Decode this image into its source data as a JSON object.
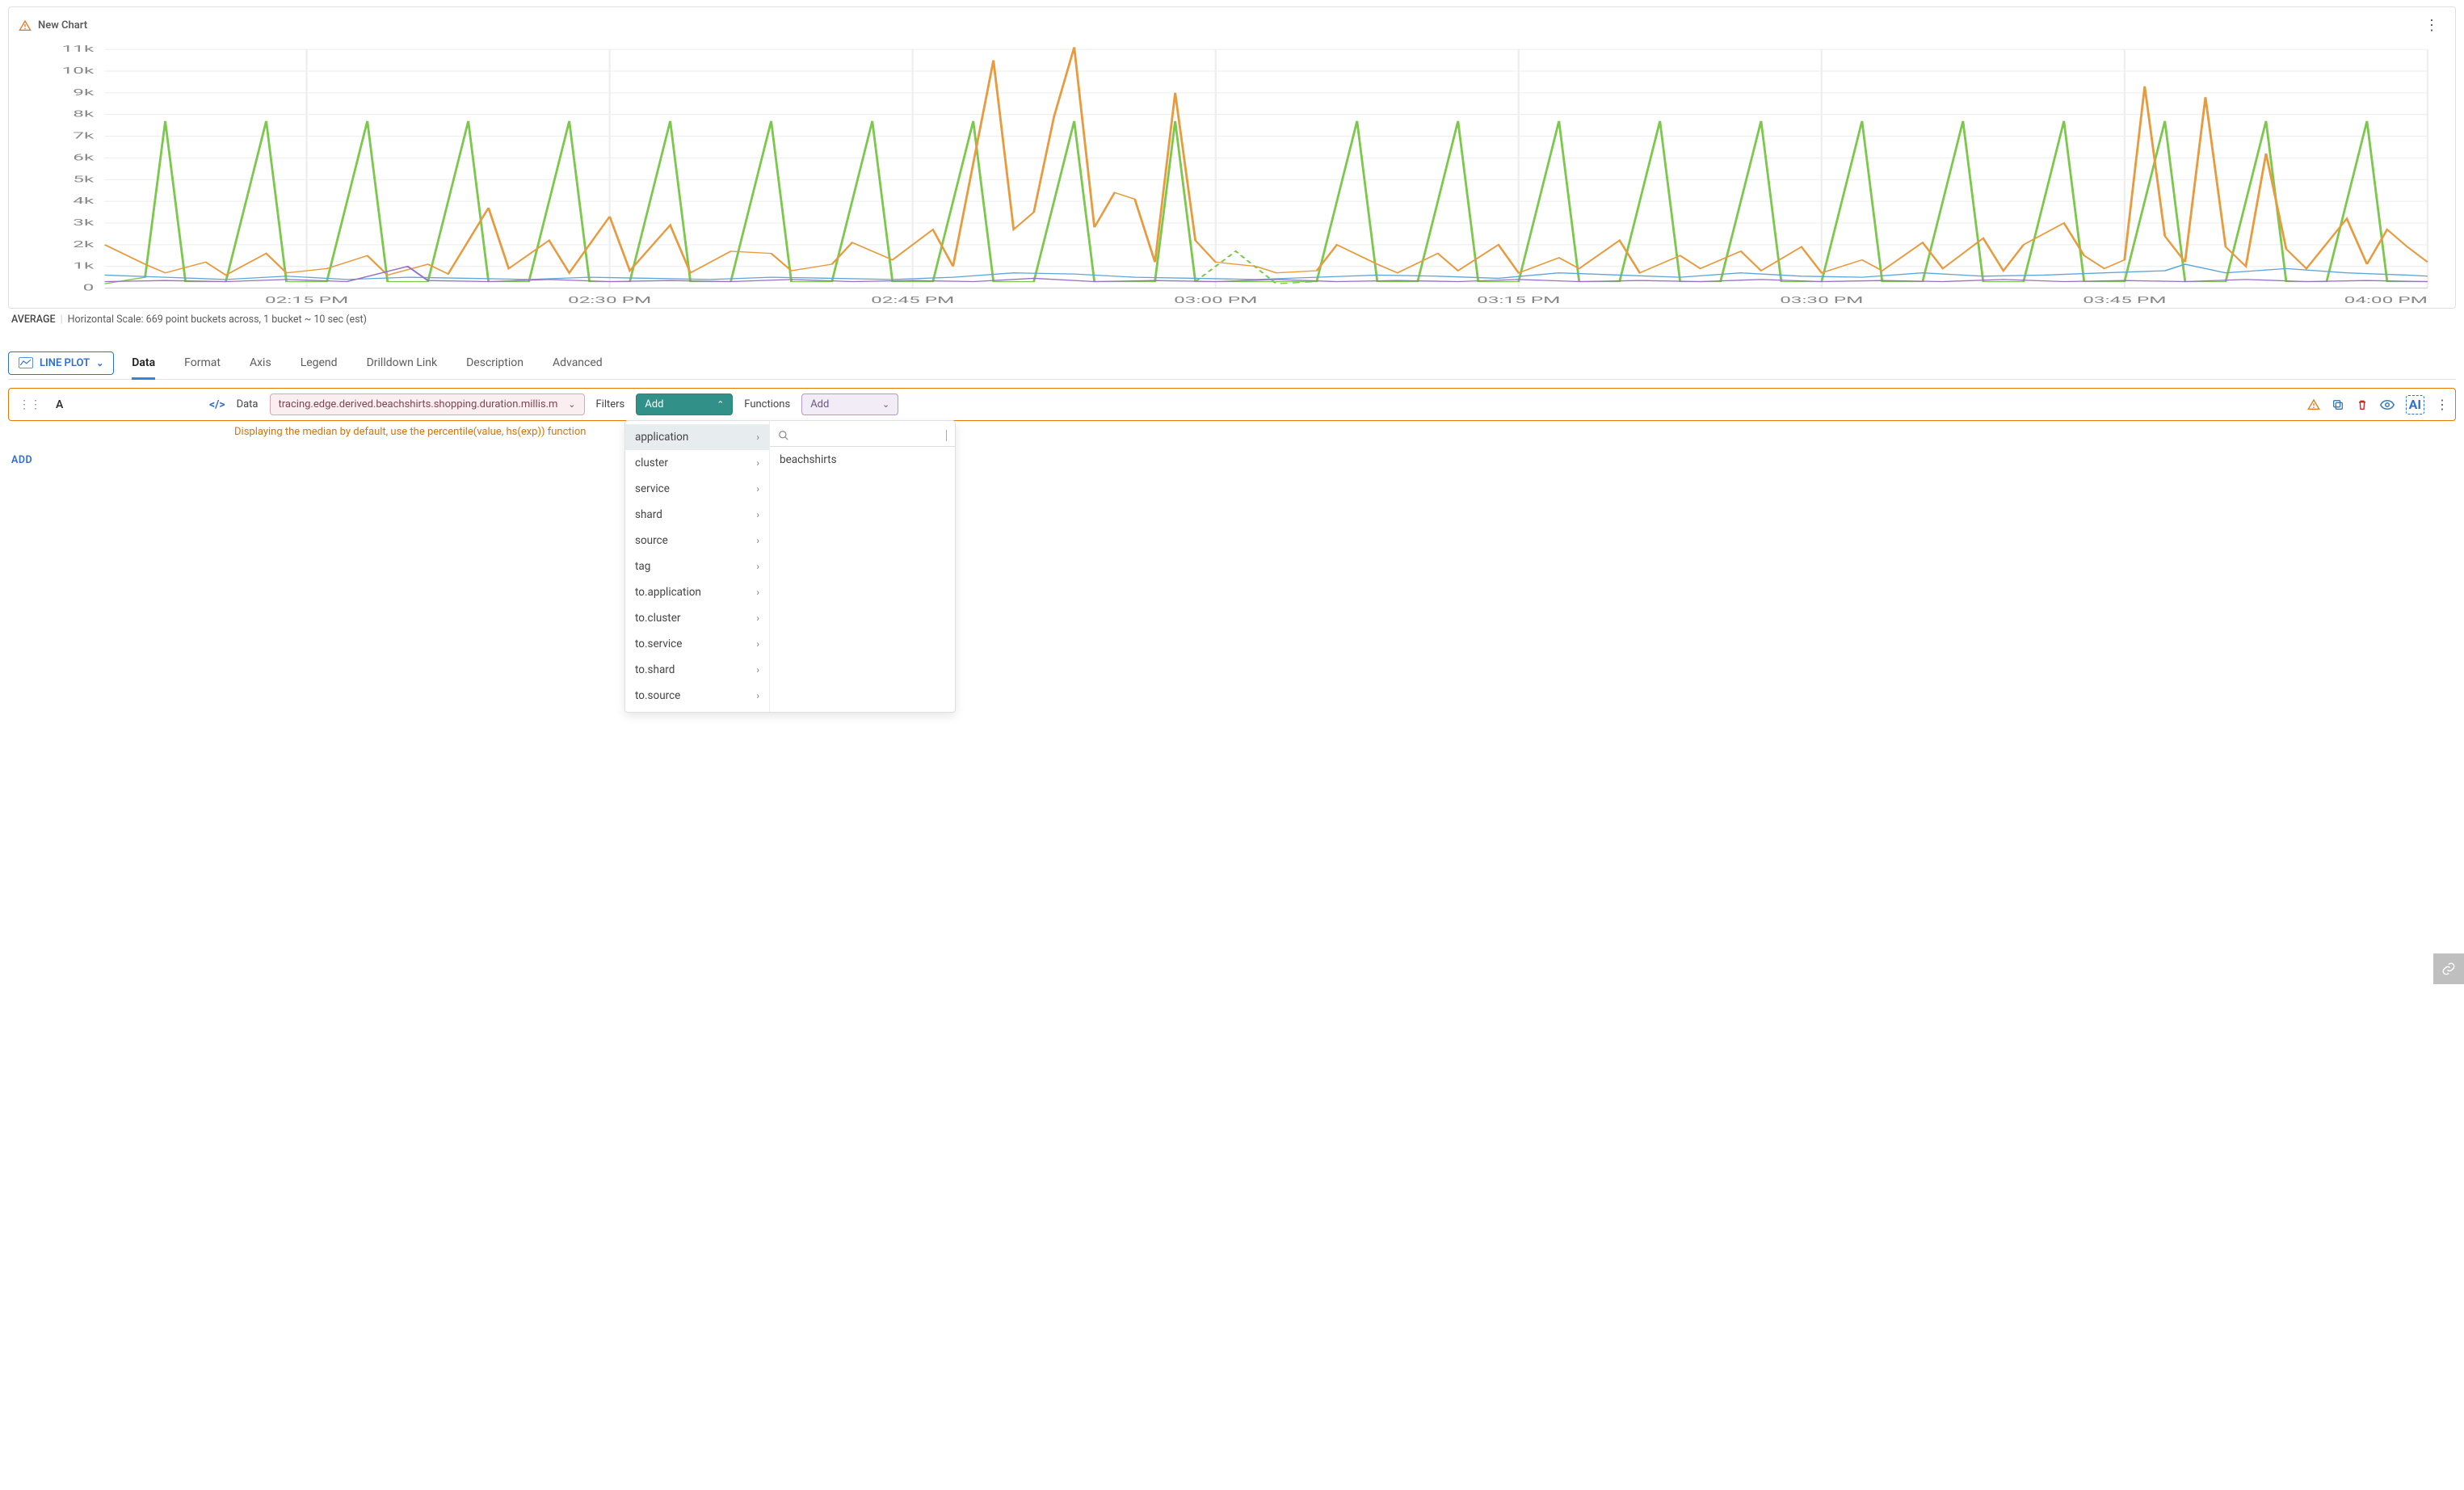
{
  "header": {
    "title": "New Chart"
  },
  "summary": {
    "metric": "AVERAGE",
    "scale": "Horizontal Scale: 669 point buckets across, 1 bucket ~ 10 sec (est)"
  },
  "plotType": {
    "label": "LINE PLOT"
  },
  "tabs": [
    "Data",
    "Format",
    "Axis",
    "Legend",
    "Drilldown Link",
    "Description",
    "Advanced"
  ],
  "activeTab": "Data",
  "query": {
    "letter": "A",
    "dataLabel": "Data",
    "metric": "tracing.edge.derived.beachshirts.shopping.duration.millis.m",
    "filtersLabel": "Filters",
    "filtersButton": "Add",
    "functionsLabel": "Functions",
    "functionsButton": "Add"
  },
  "hint": "Displaying the median by default, use the percentile(value, hs(exp)) function",
  "addLabel": "ADD",
  "filterMenu": {
    "items": [
      "application",
      "cluster",
      "service",
      "shard",
      "source",
      "tag",
      "to.application",
      "to.cluster",
      "to.service",
      "to.shard",
      "to.source"
    ],
    "selected": "application",
    "searchPlaceholder": "",
    "results": [
      "beachshirts"
    ]
  },
  "chart_data": {
    "type": "line",
    "xlabel": "",
    "ylabel": "",
    "ylim": [
      0,
      11000
    ],
    "yticks": [
      0,
      "1k",
      "2k",
      "3k",
      "4k",
      "5k",
      "6k",
      "7k",
      "8k",
      "9k",
      "10k",
      "11k"
    ],
    "xticks": [
      "02:15 PM",
      "02:30 PM",
      "02:45 PM",
      "03:00 PM",
      "03:15 PM",
      "03:30 PM",
      "03:45 PM",
      "04:00 PM"
    ],
    "x_range_minutes": [
      125,
      240
    ],
    "series": [
      {
        "name": "green",
        "color": "#7cc84c",
        "points": [
          [
            125,
            200
          ],
          [
            127,
            500
          ],
          [
            128,
            7700
          ],
          [
            129,
            300
          ],
          [
            131,
            300
          ],
          [
            133,
            7700
          ],
          [
            134,
            300
          ],
          [
            136,
            300
          ],
          [
            138,
            7700
          ],
          [
            139,
            300
          ],
          [
            141,
            300
          ],
          [
            143,
            7700
          ],
          [
            144,
            300
          ],
          [
            146,
            300
          ],
          [
            148,
            7700
          ],
          [
            149,
            300
          ],
          [
            151,
            300
          ],
          [
            153,
            7700
          ],
          [
            154,
            300
          ],
          [
            156,
            300
          ],
          [
            158,
            7700
          ],
          [
            159,
            300
          ],
          [
            161,
            300
          ],
          [
            163,
            7700
          ],
          [
            164,
            300
          ],
          [
            166,
            300
          ],
          [
            168,
            7700
          ],
          [
            169,
            300
          ],
          [
            171,
            300
          ],
          [
            173,
            7700
          ],
          [
            174,
            300
          ],
          [
            176,
            300
          ],
          [
            177,
            300
          ],
          [
            178,
            7700
          ],
          [
            179,
            300
          ],
          [
            185,
            300
          ],
          [
            187,
            7700
          ],
          [
            188,
            300
          ],
          [
            190,
            300
          ],
          [
            192,
            7700
          ],
          [
            193,
            300
          ],
          [
            195,
            300
          ],
          [
            197,
            7700
          ],
          [
            198,
            300
          ],
          [
            200,
            300
          ],
          [
            202,
            7700
          ],
          [
            203,
            300
          ],
          [
            205,
            300
          ],
          [
            207,
            7700
          ],
          [
            208,
            300
          ],
          [
            210,
            300
          ],
          [
            212,
            7700
          ],
          [
            213,
            300
          ],
          [
            215,
            300
          ],
          [
            217,
            7700
          ],
          [
            218,
            300
          ],
          [
            220,
            300
          ],
          [
            222,
            7700
          ],
          [
            223,
            300
          ],
          [
            225,
            300
          ],
          [
            227,
            7700
          ],
          [
            228,
            300
          ],
          [
            230,
            300
          ],
          [
            232,
            7700
          ],
          [
            233,
            300
          ],
          [
            235,
            300
          ],
          [
            237,
            7700
          ],
          [
            238,
            300
          ],
          [
            240,
            300
          ]
        ]
      },
      {
        "name": "green_dashed",
        "color": "#7cc84c",
        "dash": true,
        "points": [
          [
            179,
            300
          ],
          [
            181,
            1700
          ],
          [
            183,
            200
          ],
          [
            185,
            300
          ]
        ]
      },
      {
        "name": "orange",
        "color": "#e89b3e",
        "points": [
          [
            125,
            2000
          ],
          [
            127,
            1100
          ],
          [
            128,
            700
          ],
          [
            130,
            1200
          ],
          [
            131,
            600
          ],
          [
            133,
            1600
          ],
          [
            134,
            700
          ],
          [
            136,
            900
          ],
          [
            138,
            1500
          ],
          [
            139,
            600
          ],
          [
            141,
            1100
          ],
          [
            142,
            650
          ],
          [
            144,
            3700
          ],
          [
            145,
            900
          ],
          [
            147,
            2200
          ],
          [
            148,
            700
          ],
          [
            150,
            3300
          ],
          [
            151,
            800
          ],
          [
            153,
            2900
          ],
          [
            154,
            700
          ],
          [
            156,
            1700
          ],
          [
            158,
            1600
          ],
          [
            159,
            800
          ],
          [
            161,
            1100
          ],
          [
            162,
            2100
          ],
          [
            164,
            1300
          ],
          [
            166,
            2700
          ],
          [
            167,
            1000
          ],
          [
            169,
            10500
          ],
          [
            170,
            2700
          ],
          [
            171,
            3500
          ],
          [
            172,
            7900
          ],
          [
            173,
            11100
          ],
          [
            174,
            2800
          ],
          [
            175,
            4400
          ],
          [
            176,
            4100
          ],
          [
            177,
            1200
          ],
          [
            178,
            9000
          ],
          [
            179,
            2200
          ],
          [
            180,
            1200
          ],
          [
            182,
            1000
          ],
          [
            183,
            700
          ],
          [
            185,
            800
          ],
          [
            186,
            2000
          ],
          [
            188,
            1100
          ],
          [
            189,
            700
          ],
          [
            191,
            1600
          ],
          [
            192,
            800
          ],
          [
            194,
            2000
          ],
          [
            195,
            700
          ],
          [
            197,
            1400
          ],
          [
            198,
            900
          ],
          [
            200,
            2200
          ],
          [
            201,
            700
          ],
          [
            203,
            1500
          ],
          [
            204,
            900
          ],
          [
            206,
            1700
          ],
          [
            207,
            800
          ],
          [
            209,
            1900
          ],
          [
            210,
            700
          ],
          [
            212,
            1300
          ],
          [
            213,
            800
          ],
          [
            215,
            2100
          ],
          [
            216,
            900
          ],
          [
            218,
            2300
          ],
          [
            219,
            800
          ],
          [
            220,
            2000
          ],
          [
            222,
            3000
          ],
          [
            223,
            1500
          ],
          [
            224,
            900
          ],
          [
            225,
            1300
          ],
          [
            226,
            9300
          ],
          [
            227,
            2400
          ],
          [
            228,
            1200
          ],
          [
            229,
            8800
          ],
          [
            230,
            1900
          ],
          [
            231,
            1000
          ],
          [
            232,
            6200
          ],
          [
            233,
            1800
          ],
          [
            234,
            900
          ],
          [
            236,
            3200
          ],
          [
            237,
            1100
          ],
          [
            238,
            2700
          ],
          [
            239,
            1900
          ],
          [
            240,
            1200
          ]
        ]
      },
      {
        "name": "blue",
        "color": "#5fa6d8",
        "points": [
          [
            125,
            600
          ],
          [
            128,
            500
          ],
          [
            131,
            400
          ],
          [
            134,
            550
          ],
          [
            137,
            400
          ],
          [
            140,
            500
          ],
          [
            143,
            450
          ],
          [
            146,
            400
          ],
          [
            149,
            500
          ],
          [
            152,
            450
          ],
          [
            155,
            400
          ],
          [
            158,
            500
          ],
          [
            161,
            450
          ],
          [
            164,
            400
          ],
          [
            167,
            500
          ],
          [
            170,
            700
          ],
          [
            173,
            650
          ],
          [
            176,
            500
          ],
          [
            179,
            450
          ],
          [
            182,
            400
          ],
          [
            185,
            500
          ],
          [
            188,
            600
          ],
          [
            191,
            550
          ],
          [
            194,
            450
          ],
          [
            197,
            700
          ],
          [
            200,
            600
          ],
          [
            203,
            500
          ],
          [
            206,
            700
          ],
          [
            209,
            550
          ],
          [
            212,
            500
          ],
          [
            215,
            700
          ],
          [
            218,
            550
          ],
          [
            221,
            600
          ],
          [
            224,
            700
          ],
          [
            227,
            800
          ],
          [
            228,
            1100
          ],
          [
            230,
            700
          ],
          [
            233,
            900
          ],
          [
            236,
            700
          ],
          [
            239,
            600
          ],
          [
            240,
            550
          ]
        ]
      },
      {
        "name": "purple",
        "color": "#9a6fc8",
        "points": [
          [
            125,
            300
          ],
          [
            128,
            350
          ],
          [
            131,
            300
          ],
          [
            134,
            400
          ],
          [
            137,
            300
          ],
          [
            140,
            1000
          ],
          [
            141,
            350
          ],
          [
            144,
            300
          ],
          [
            147,
            400
          ],
          [
            150,
            300
          ],
          [
            153,
            350
          ],
          [
            156,
            300
          ],
          [
            159,
            400
          ],
          [
            162,
            300
          ],
          [
            165,
            350
          ],
          [
            168,
            300
          ],
          [
            171,
            450
          ],
          [
            174,
            300
          ],
          [
            177,
            350
          ],
          [
            180,
            300
          ],
          [
            183,
            400
          ],
          [
            186,
            300
          ],
          [
            189,
            350
          ],
          [
            192,
            300
          ],
          [
            195,
            400
          ],
          [
            198,
            300
          ],
          [
            201,
            350
          ],
          [
            204,
            300
          ],
          [
            207,
            400
          ],
          [
            210,
            300
          ],
          [
            213,
            350
          ],
          [
            216,
            300
          ],
          [
            219,
            400
          ],
          [
            222,
            300
          ],
          [
            225,
            350
          ],
          [
            228,
            300
          ],
          [
            231,
            400
          ],
          [
            234,
            300
          ],
          [
            237,
            350
          ],
          [
            240,
            300
          ]
        ]
      }
    ]
  }
}
